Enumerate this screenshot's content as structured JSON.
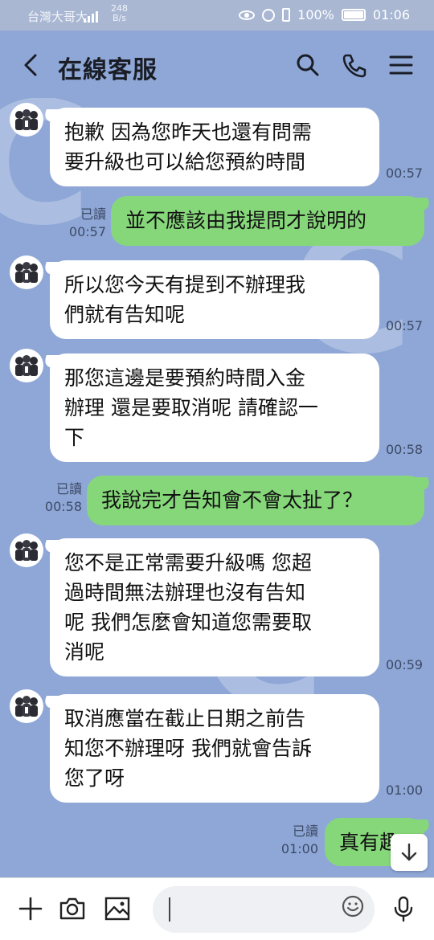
{
  "status_bar": {
    "carrier": "台灣大哥大",
    "network_type": "4G",
    "speed_value": "248",
    "speed_unit": "B/s",
    "battery": "100%",
    "time": "01:06"
  },
  "header": {
    "title": "在線客服",
    "icons": [
      "back-arrow",
      "search",
      "phone",
      "menu"
    ]
  },
  "messages": [
    {
      "id": 1,
      "side": "in",
      "lines": [
        "抱歉 因為您昨天也還有問需",
        "要升級也可以給您預約時間"
      ],
      "time": "00:57"
    },
    {
      "id": 2,
      "side": "out",
      "lines": [
        "並不應該由我提問才說明的"
      ],
      "time": "00:57",
      "read": "已讀"
    },
    {
      "id": 3,
      "side": "in",
      "lines": [
        "所以您今天有提到不辦理我",
        "們就有告知呢"
      ],
      "time": "00:57"
    },
    {
      "id": 4,
      "side": "in",
      "lines": [
        "那您這邊是要預約時間入金",
        "辦理 還是要取消呢 請確認一",
        "下"
      ],
      "time": "00:58"
    },
    {
      "id": 5,
      "side": "out",
      "lines": [
        "我說完才告知會不會太扯了？"
      ],
      "time": "00:58",
      "read": "已讀"
    },
    {
      "id": 6,
      "side": "in",
      "lines": [
        "您不是正常需要升級嗎 您超",
        "過時間無法辦理也沒有告知",
        "呢 我們怎麼會知道您需要取",
        "消呢"
      ],
      "time": "00:59"
    },
    {
      "id": 7,
      "side": "in",
      "lines": [
        "取消應當在截止日期之前告",
        "知您不辦理呀 我們就會告訴",
        "您了呀"
      ],
      "time": "01:00"
    },
    {
      "id": 8,
      "side": "out",
      "lines": [
        "真有趣"
      ],
      "time": "01:00",
      "read": "已讀"
    }
  ],
  "input_bar": {
    "placeholder": "",
    "icons": [
      "plus",
      "camera",
      "image",
      "emoji",
      "microphone"
    ]
  },
  "colors": {
    "chat_background": "#8ea7d6",
    "outgoing_bubble": "#86d77a",
    "incoming_bubble": "#ffffff"
  }
}
